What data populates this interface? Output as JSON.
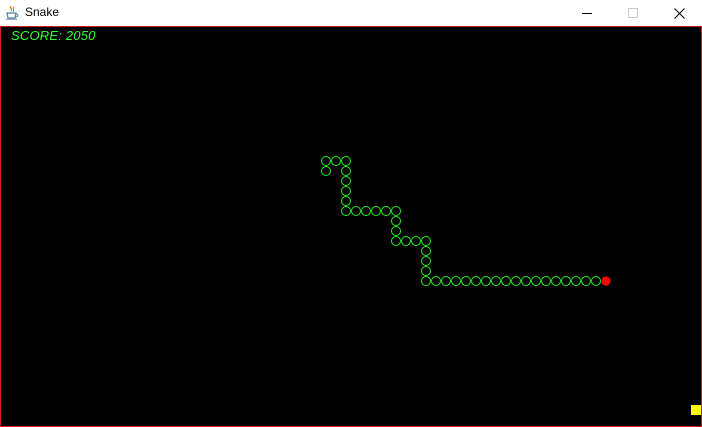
{
  "window": {
    "title": "Snake",
    "controls": {
      "minimize": "minimize-icon",
      "maximize": "maximize-icon",
      "close": "close-icon"
    },
    "icon": "java-cup-icon"
  },
  "game": {
    "score_text": "SCORE: 2050",
    "colors": {
      "background": "#000000",
      "border": "#d11c1c",
      "snake_body": "#22ee22",
      "snake_head": "#ff0000",
      "food": "#ffff00",
      "score": "#33ff33"
    }
  }
}
